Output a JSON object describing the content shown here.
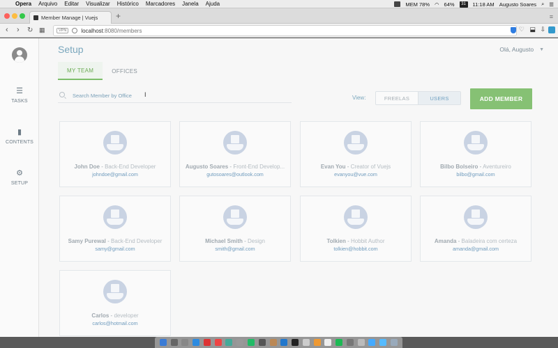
{
  "menubar": {
    "app": "Opera",
    "items": [
      "Arquivo",
      "Editar",
      "Visualizar",
      "Histórico",
      "Marcadores",
      "Janela",
      "Ajuda"
    ],
    "battery": "64%",
    "date_badge": "31",
    "time": "11:18 AM",
    "user": "Augusto Soares",
    "mem": "MEM 78%"
  },
  "browser": {
    "tab_title": "Member Manage | Vuejs",
    "url_host": "localhost",
    "url_path": ":8080/members",
    "vpn": "VPN"
  },
  "sidebar": {
    "items": [
      {
        "label": "TASKS",
        "icon": "list-icon"
      },
      {
        "label": "CONTENTS",
        "icon": "film-icon"
      },
      {
        "label": "SETUP",
        "icon": "gear-icon"
      }
    ]
  },
  "header": {
    "title": "Setup",
    "greeting": "Olá, Augusto"
  },
  "tabs": [
    "MY TEAM",
    "OFFICES"
  ],
  "search": {
    "placeholder": "Search Member by Office"
  },
  "view": {
    "label": "View:",
    "options": [
      "FREELAS",
      "USERS"
    ],
    "selected": "USERS"
  },
  "add_button": "ADD MEMBER",
  "members": [
    {
      "name": "John Doe",
      "role": "Back-End Developer",
      "email": "johndoe@gmail.com"
    },
    {
      "name": "Augusto Soares",
      "role": "Front-End Develop...",
      "email": "gutosoares@outlook.com"
    },
    {
      "name": "Evan You",
      "role": "Creator of Vuejs",
      "email": "evanyou@vue.com"
    },
    {
      "name": "Bilbo Bolseiro",
      "role": "Aventureiro",
      "email": "bilbo@gmail.com"
    },
    {
      "name": "Samy Purewal",
      "role": "Back-End Developer",
      "email": "samy@gmail.com"
    },
    {
      "name": "Michael Smith",
      "role": "Design",
      "email": "smith@gmail.com"
    },
    {
      "name": "Tolkien",
      "role": "Hobbit Author",
      "email": "tolkien@hobbit.com"
    },
    {
      "name": "Amanda",
      "role": "Baladeira com certeza",
      "email": "amanda@gmail.com"
    },
    {
      "name": "Carlos",
      "role": "developer",
      "email": "carlos@hotmail.com"
    }
  ],
  "colors": {
    "accent_green": "#86c174",
    "title_blue": "#7aa7bd",
    "email_blue": "#6f9bbd"
  }
}
